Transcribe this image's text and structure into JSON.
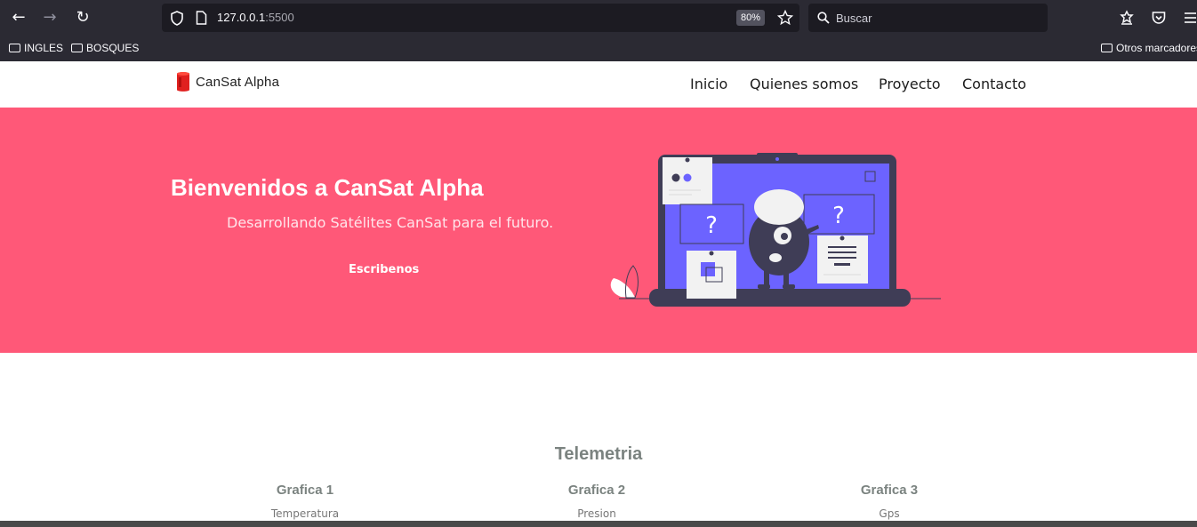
{
  "browser": {
    "url_host": "127.0.0.1",
    "url_port": ":5500",
    "zoom": "80%",
    "search_placeholder": "Buscar",
    "bookmarks": [
      "INGLES",
      "BOSQUES"
    ],
    "other_bookmarks": "Otros marcadores"
  },
  "site": {
    "logo_text": "CanSat  Alpha",
    "nav": [
      "Inicio",
      "Quienes somos",
      "Proyecto",
      "Contacto"
    ]
  },
  "hero": {
    "title": "Bienvenidos a CanSat Alpha",
    "subtitle": "Desarrollando Satélites CanSat para el futuro.",
    "button": "Escribenos"
  },
  "telemetry": {
    "title": "Telemetria",
    "graphs": [
      {
        "title": "Grafica 1",
        "subtitle": "Temperatura"
      },
      {
        "title": "Grafica 2",
        "subtitle": "Presion"
      },
      {
        "title": "Grafica 3",
        "subtitle": "Gps"
      }
    ]
  },
  "colors": {
    "hero_bg": "#ff5878",
    "accent_purple": "#6c63ff",
    "browser_bg": "#2b2a33"
  }
}
